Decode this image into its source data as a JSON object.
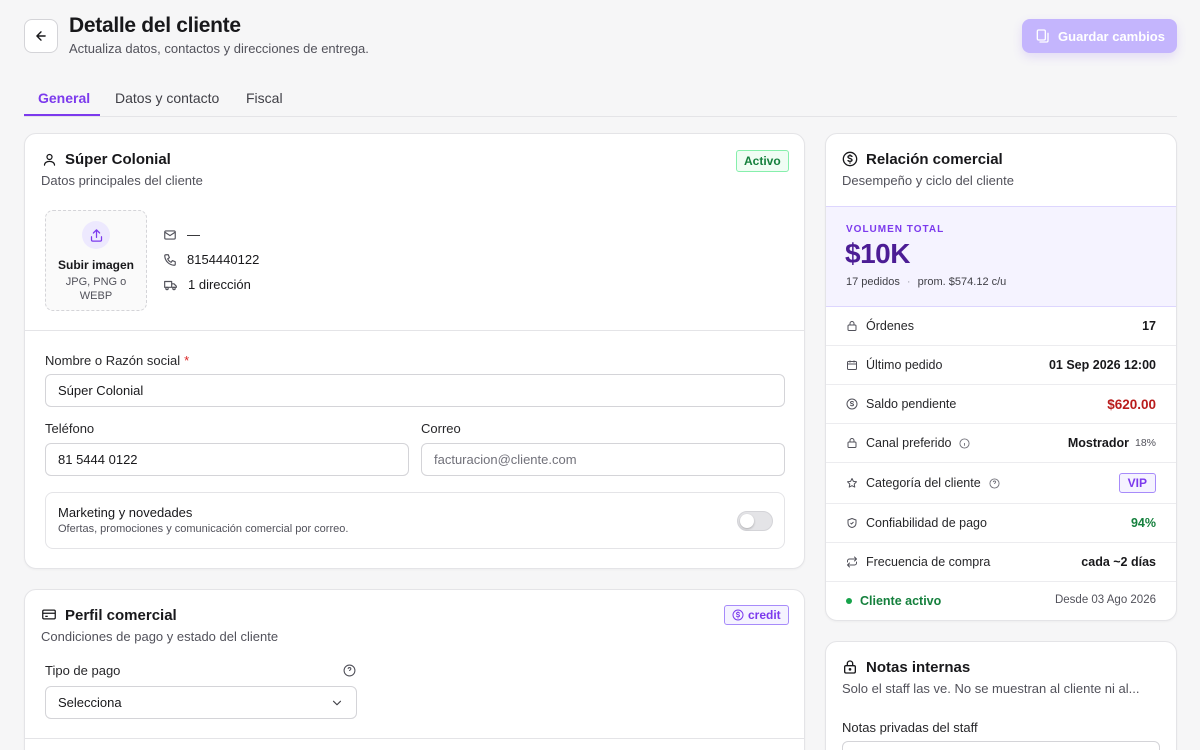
{
  "header": {
    "title": "Detalle del cliente",
    "subtitle": "Actualiza datos, contactos y direcciones de entrega.",
    "save_label": "Guardar cambios"
  },
  "tabs": [
    {
      "label": "General",
      "active": true
    },
    {
      "label": "Datos y contacto",
      "active": false
    },
    {
      "label": "Fiscal",
      "active": false
    }
  ],
  "customer_card": {
    "title": "Súper Colonial",
    "subtitle": "Datos principales del cliente",
    "status_badge": "Activo",
    "upload": {
      "title": "Subir imagen",
      "hint": "JPG, PNG o WEBP"
    },
    "contact": {
      "email": "—",
      "phone": "8154440122",
      "addresses": "1 dirección"
    },
    "fields": {
      "name_label": "Nombre o Razón social",
      "name_required": "*",
      "name_value": "Súper Colonial",
      "phone_label": "Teléfono",
      "phone_value": "81 5444 0122",
      "email_label": "Correo",
      "email_placeholder": "facturacion@cliente.com"
    },
    "marketing": {
      "title": "Marketing y novedades",
      "description": "Ofertas, promociones y comunicación comercial por correo.",
      "enabled": false
    }
  },
  "commercial_card": {
    "title": "Perfil comercial",
    "subtitle": "Condiciones de pago y estado del cliente",
    "badge": "credit",
    "payment_type_label": "Tipo de pago",
    "payment_type_value": "Selecciona"
  },
  "relation_card": {
    "title": "Relación comercial",
    "subtitle": "Desempeño y ciclo del cliente",
    "volume_label": "VOLUMEN TOTAL",
    "volume_value": "$10K",
    "volume_orders": "17 pedidos",
    "volume_avg": "prom. $574.12 c/u",
    "metrics": {
      "orders_label": "Órdenes",
      "orders_value": "17",
      "last_order_label": "Último pedido",
      "last_order_value": "01 Sep 2026 12:00",
      "balance_label": "Saldo pendiente",
      "balance_value": "$620.00",
      "channel_label": "Canal preferido",
      "channel_value": "Mostrador",
      "channel_pct": "18%",
      "category_label": "Categoría del cliente",
      "category_value": "VIP",
      "reliability_label": "Confiabilidad de pago",
      "reliability_value": "94%",
      "frequency_label": "Frecuencia de compra",
      "frequency_value": "cada ~2 días"
    },
    "footer_status": "Cliente activo",
    "footer_since": "Desde 03 Ago 2026"
  },
  "notes_card": {
    "title": "Notas internas",
    "subtitle": "Solo el staff las ve. No se muestran al cliente ni al...",
    "field_label": "Notas privadas del staff"
  },
  "colors": {
    "accent": "#7c3aed",
    "success": "#15803d",
    "danger": "#b91c1c",
    "volume_band": "#f5f3ff"
  }
}
